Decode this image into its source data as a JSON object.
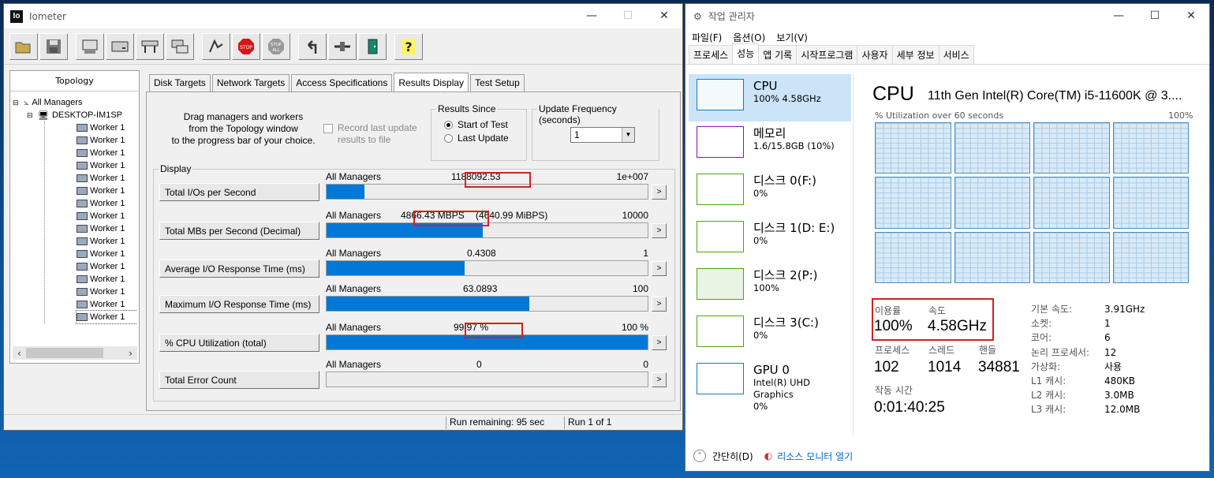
{
  "iometer": {
    "title": "Iometer",
    "logo": "Io",
    "toolbar": [
      "open-icon",
      "save-icon",
      "new-manager-icon",
      "new-disk-worker-icon",
      "new-network-worker-icon",
      "duplicate-worker-icon",
      "start-icon",
      "stop-icon",
      "stop-all-icon",
      "reset-icon",
      "disconnect-icon",
      "exit-icon",
      "help-icon"
    ],
    "topology": {
      "header": "Topology",
      "root": "All Managers",
      "manager": "DESKTOP-IM1SP",
      "workers": [
        "Worker 1",
        "Worker 1",
        "Worker 1",
        "Worker 1",
        "Worker 1",
        "Worker 1",
        "Worker 1",
        "Worker 1",
        "Worker 1",
        "Worker 1",
        "Worker 1",
        "Worker 1",
        "Worker 1",
        "Worker 1",
        "Worker 1",
        "Worker 1"
      ]
    },
    "tabs": [
      "Disk Targets",
      "Network Targets",
      "Access Specifications",
      "Results Display",
      "Test Setup"
    ],
    "active_tab": "Results Display",
    "drag_text": [
      "Drag managers and workers",
      "from the Topology window",
      "to the progress bar of your choice."
    ],
    "record": [
      "Record last update",
      "results to file"
    ],
    "results_since": {
      "title": "Results Since",
      "options": [
        "Start of Test",
        "Last Update"
      ],
      "selected": "Start of Test"
    },
    "update_frequency": {
      "title": "Update Frequency (seconds)",
      "value": "1"
    },
    "display_title": "Display",
    "rows": [
      {
        "button": "Total I/Os per Second",
        "manager": "All Managers",
        "value": "1188092.53",
        "max": "1e+007",
        "fill": 0.118
      },
      {
        "button": "Total MBs per Second (Decimal)",
        "manager": "All Managers",
        "value": "4866.43 MBPS",
        "value_extra": "(4640.99 MiBPS)",
        "max": "10000",
        "fill": 0.487
      },
      {
        "button": "Average I/O Response Time (ms)",
        "manager": "All Managers",
        "value": "0.4308",
        "max": "1",
        "fill": 0.431
      },
      {
        "button": "Maximum I/O Response Time (ms)",
        "manager": "All Managers",
        "value": "63.0893",
        "max": "100",
        "fill": 0.631
      },
      {
        "button": "% CPU Utilization (total)",
        "manager": "All Managers",
        "value": "99.97 %",
        "max": "100 %",
        "fill": 0.9997
      },
      {
        "button": "Total Error Count",
        "manager": "All Managers",
        "value": "0",
        "max": "0",
        "fill": 0
      }
    ],
    "more": ">",
    "status": {
      "remaining": "Run remaining: 95 sec",
      "run": "Run 1 of 1"
    }
  },
  "taskmgr": {
    "title": "작업 관리자",
    "menu": [
      "파일(F)",
      "옵션(O)",
      "보기(V)"
    ],
    "tabs": [
      "프로세스",
      "성능",
      "앱 기록",
      "시작프로그램",
      "사용자",
      "세부 정보",
      "서비스"
    ],
    "active_tab": "성능",
    "sidebar": [
      {
        "name": "CPU",
        "sub": "100% 4.58GHz",
        "color": "#117dbb"
      },
      {
        "name": "메모리",
        "sub": "1.6/15.8GB (10%)",
        "color": "#8b12ae"
      },
      {
        "name": "디스크 0(F:)",
        "sub": "0%",
        "color": "#4da60c"
      },
      {
        "name": "디스크 1(D: E:)",
        "sub": "0%",
        "color": "#4da60c"
      },
      {
        "name": "디스크 2(P:)",
        "sub": "100%",
        "color": "#4da60c"
      },
      {
        "name": "디스크 3(C:)",
        "sub": "0%",
        "color": "#4da60c"
      },
      {
        "name": "GPU 0",
        "sub": "Intel(R) UHD Graphics",
        "sub2": "0%",
        "color": "#117dbb"
      }
    ],
    "cpu": {
      "title": "CPU",
      "model": "11th Gen Intel(R) Core(TM) i5-11600K @ 3....",
      "graph_label": "% Utilization over 60 seconds",
      "graph_max": "100%",
      "utilization_label": "이용률",
      "utilization": "100%",
      "speed_label": "속도",
      "speed": "4.58GHz",
      "processes_label": "프로세스",
      "processes": "102",
      "threads_label": "스레드",
      "threads": "1014",
      "handles_label": "핸들",
      "handles": "34881",
      "uptime_label": "작동 시간",
      "uptime": "0:01:40:25",
      "specs": [
        {
          "k": "기본 속도:",
          "v": "3.91GHz"
        },
        {
          "k": "소켓:",
          "v": "1"
        },
        {
          "k": "코어:",
          "v": "6"
        },
        {
          "k": "논리 프로세서:",
          "v": "12"
        },
        {
          "k": "가상화:",
          "v": "사용"
        },
        {
          "k": "L1 캐시:",
          "v": "480KB"
        },
        {
          "k": "L2 캐시:",
          "v": "3.0MB"
        },
        {
          "k": "L3 캐시:",
          "v": "12.0MB"
        }
      ]
    },
    "footer": {
      "less": "간단히(D)",
      "monitor": "리소스 모니터 열기"
    }
  }
}
